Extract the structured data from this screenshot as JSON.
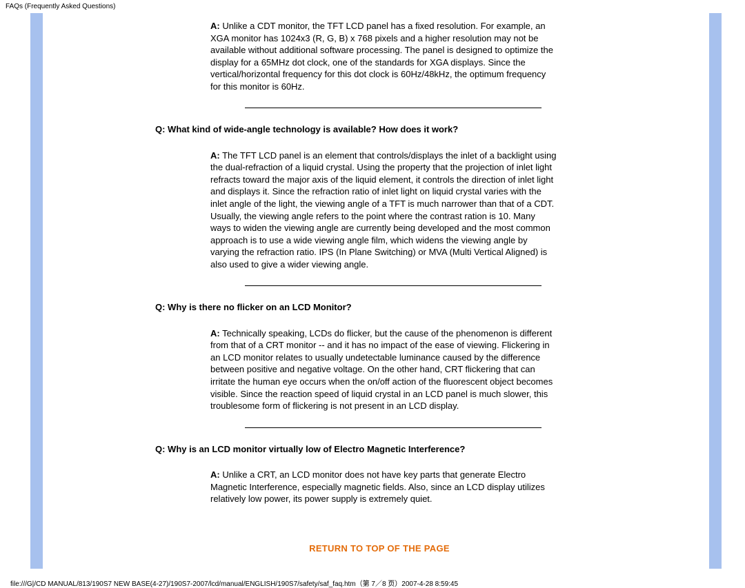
{
  "header": "FAQs (Frequently Asked Questions)",
  "faq1": {
    "a_label": "A:",
    "a_text": " Unlike a CDT monitor, the TFT LCD panel has a fixed resolution. For example, an XGA monitor has 1024x3 (R, G, B) x 768 pixels and a higher resolution may not be available without additional software processing. The panel is designed to optimize the display for a 65MHz dot clock, one of the standards for XGA displays. Since the vertical/horizontal frequency for this dot clock is 60Hz/48kHz, the optimum frequency for this monitor is 60Hz."
  },
  "faq2": {
    "q": "Q: What kind of wide-angle technology is available? How does it work?",
    "a_label": "A:",
    "a_text": " The TFT LCD panel is an element that controls/displays the inlet of a backlight using the dual-refraction of a liquid crystal. Using the property that the projection of inlet light refracts toward the major axis of the liquid element, it controls the direction of inlet light and displays it. Since the refraction ratio of inlet light on liquid crystal varies with the inlet angle of the light, the viewing angle of a TFT is much narrower than that of a CDT. Usually, the viewing angle refers to the point where the contrast ration is 10. Many ways to widen the viewing angle are currently being developed and the most common approach is to use a wide viewing angle film, which widens the viewing angle by varying the refraction ratio. IPS (In Plane Switching) or MVA (Multi Vertical Aligned) is also used to give a wider viewing angle."
  },
  "faq3": {
    "q": "Q: Why is there no flicker on an LCD Monitor?",
    "a_label": "A:",
    "a_text": " Technically speaking, LCDs do flicker, but the cause of the phenomenon is different from that of a CRT monitor -- and it has no impact of the ease of viewing. Flickering in an LCD monitor relates to usually undetectable luminance caused by the difference between positive and negative voltage. On the other hand, CRT flickering that can irritate the human eye occurs when the on/off action of the fluorescent object becomes visible. Since the reaction speed of liquid crystal in an LCD panel is much slower, this troublesome form of flickering is not present in an LCD display."
  },
  "faq4": {
    "q": "Q: Why is an LCD monitor virtually low of Electro Magnetic Interference?",
    "a_label": "A:",
    "a_text": " Unlike a CRT, an LCD monitor does not have key parts that generate Electro Magnetic Interference, especially magnetic fields. Also, since an LCD display utilizes relatively low power, its power supply is extremely quiet."
  },
  "return_link": "RETURN TO TOP OF THE PAGE",
  "footer": "file:///G|/CD MANUAL/813/190S7 NEW BASE(4-27)/190S7-2007/lcd/manual/ENGLISH/190S7/safety/saf_faq.htm（第 7／8 页）2007-4-28 8:59:45"
}
